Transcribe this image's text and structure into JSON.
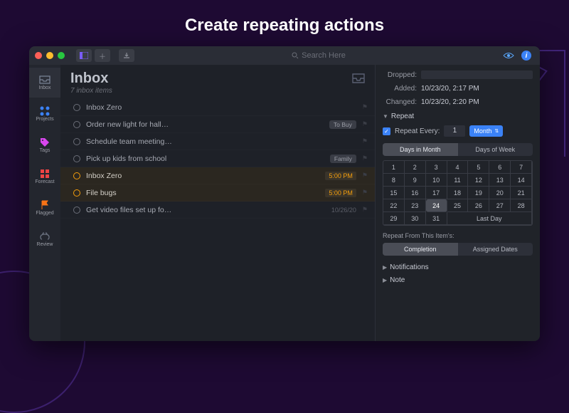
{
  "page_heading": "Create repeating actions",
  "toolbar": {
    "search_placeholder": "Search Here"
  },
  "sidebar": {
    "items": [
      {
        "id": "inbox",
        "label": "Inbox"
      },
      {
        "id": "projects",
        "label": "Projects"
      },
      {
        "id": "tags",
        "label": "Tags"
      },
      {
        "id": "forecast",
        "label": "Forecast"
      },
      {
        "id": "flagged",
        "label": "Flagged"
      },
      {
        "id": "review",
        "label": "Review"
      }
    ]
  },
  "main": {
    "title": "Inbox",
    "subtitle": "7 inbox items",
    "items": [
      {
        "title": "Inbox Zero",
        "tag": "",
        "due": "",
        "date": "",
        "sel": false
      },
      {
        "title": "Order new light for hall…",
        "tag": "To Buy",
        "due": "",
        "date": "",
        "sel": false
      },
      {
        "title": "Schedule team meeting…",
        "tag": "",
        "due": "",
        "date": "",
        "sel": false
      },
      {
        "title": "Pick up kids from school",
        "tag": "Family",
        "due": "",
        "date": "",
        "sel": false
      },
      {
        "title": "Inbox Zero",
        "tag": "",
        "due": "5:00 PM",
        "date": "",
        "sel": true
      },
      {
        "title": "File bugs",
        "tag": "",
        "due": "5:00 PM",
        "date": "",
        "sel": true
      },
      {
        "title": "Get video files set up fo…",
        "tag": "",
        "due": "",
        "date": "10/26/20",
        "sel": false
      }
    ]
  },
  "inspector": {
    "dropped_label": "Dropped:",
    "added_label": "Added:",
    "added_value": "10/23/20, 2:17 PM",
    "changed_label": "Changed:",
    "changed_value": "10/23/20, 2:20 PM",
    "repeat_section": "Repeat",
    "repeat_every_label": "Repeat Every:",
    "repeat_every_value": "1",
    "repeat_unit": "Month",
    "seg_days_month": "Days in Month",
    "seg_days_week": "Days of Week",
    "calendar": {
      "days": [
        1,
        2,
        3,
        4,
        5,
        6,
        7,
        8,
        9,
        10,
        11,
        12,
        13,
        14,
        15,
        16,
        17,
        18,
        19,
        20,
        21,
        22,
        23,
        24,
        25,
        26,
        27,
        28,
        29,
        30,
        31
      ],
      "selected": 24,
      "last_day_label": "Last Day"
    },
    "repeat_from_label": "Repeat From This Item's:",
    "seg_completion": "Completion",
    "seg_assigned": "Assigned Dates",
    "notifications_section": "Notifications",
    "note_section": "Note"
  }
}
